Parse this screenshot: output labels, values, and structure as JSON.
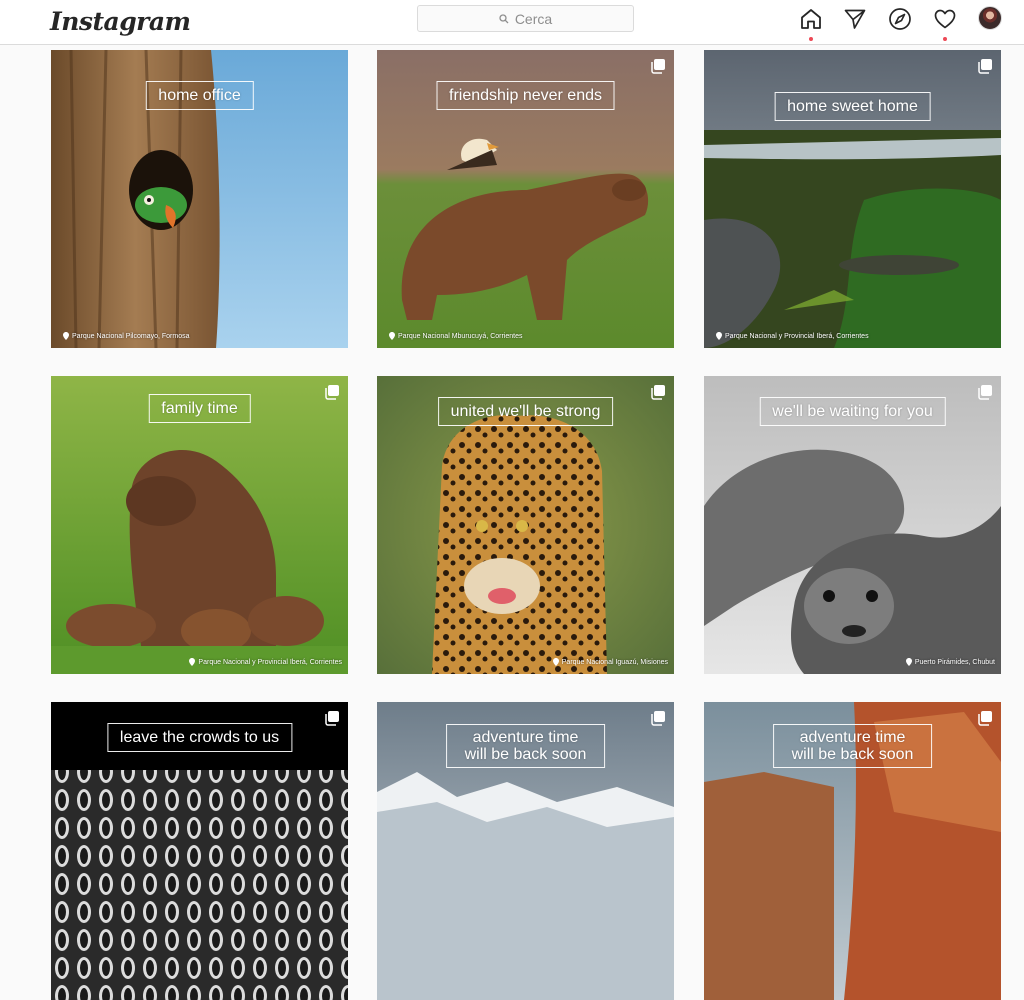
{
  "header": {
    "logo_text": "Instagram",
    "search_placeholder": "Cerca",
    "icons": [
      "home-icon",
      "direct-message-icon",
      "explore-compass-icon",
      "activity-heart-icon",
      "profile-avatar"
    ],
    "notification_color": "#ed4956"
  },
  "posts": [
    {
      "caption": "home office",
      "location": "Parque Nacional Pilcomayo, Formosa",
      "multi": false
    },
    {
      "caption": "friendship never ends",
      "location": "Parque Nacional Mburucuyá, Corrientes",
      "multi": true
    },
    {
      "caption": "home sweet home",
      "location": "Parque Nacional y Provincial Iberá, Corrientes",
      "multi": true
    },
    {
      "caption": "family time",
      "location": "Parque Nacional y Provincial Iberá, Corrientes",
      "multi": true
    },
    {
      "caption": "united we'll be strong",
      "location": "Parque Nacional Iguazú, Misiones",
      "multi": true
    },
    {
      "caption": "we'll be waiting for you",
      "location": "Puerto Pirámides, Chubut",
      "multi": true
    },
    {
      "caption": "leave the crowds to us",
      "location": "",
      "multi": true
    },
    {
      "caption_line1": "adventure time",
      "caption_line2": "will be back soon",
      "multi": true
    },
    {
      "caption_line1": "adventure time",
      "caption_line2": "will be back soon",
      "multi": true
    }
  ]
}
